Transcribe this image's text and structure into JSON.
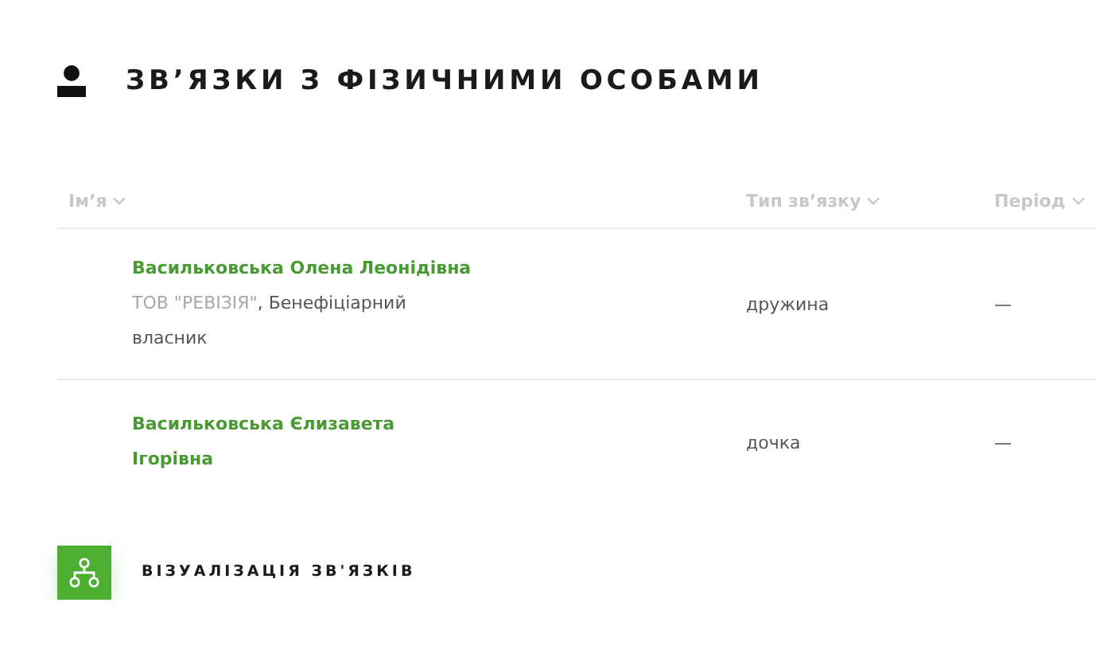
{
  "section": {
    "title": "ЗВ’ЯЗКИ З ФІЗИЧНИМИ ОСОБАМИ"
  },
  "table": {
    "columns": [
      {
        "label": "Ім’я"
      },
      {
        "label": "Тип зв’язку"
      },
      {
        "label": "Період"
      }
    ],
    "rows": [
      {
        "name": "Васильковська Олена Леонідівна",
        "company": "ТОВ \"РЕВІЗІЯ\"",
        "role": ", Бенефіціарний власник",
        "relation": "дружина",
        "period": "—"
      },
      {
        "name": "Васильковська Єлизавета Ігорівна",
        "relation": "дочка",
        "period": "—"
      }
    ]
  },
  "visualize_button": {
    "label": "ВІЗУАЛІЗАЦІЯ ЗВ'ЯЗКІВ"
  }
}
